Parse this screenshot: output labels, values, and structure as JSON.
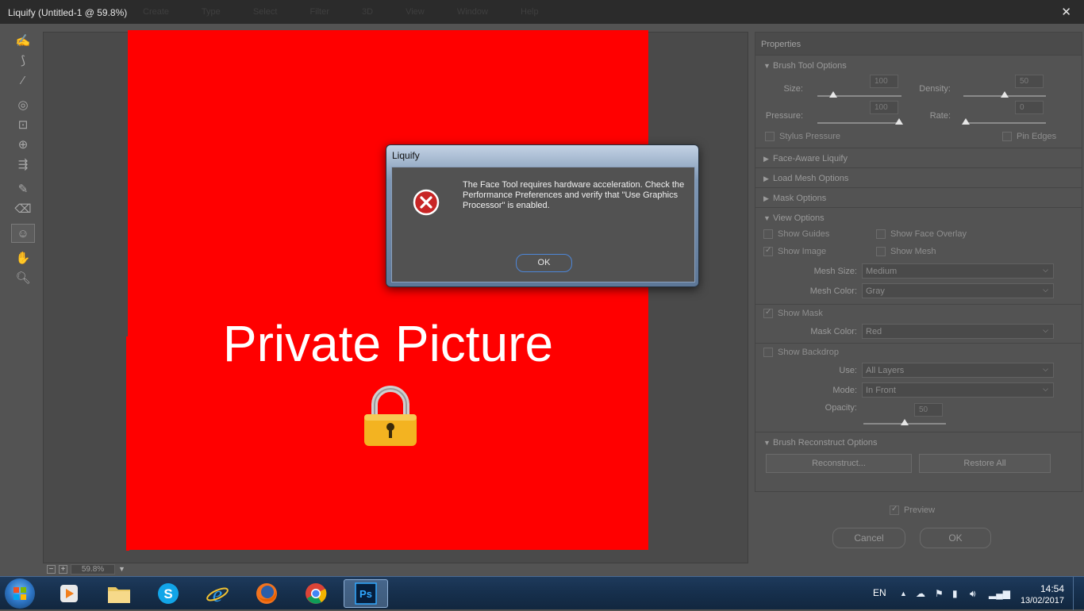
{
  "window": {
    "title": "Liquify (Untitled-1 @ 59.8%)",
    "close_glyph": "✕",
    "ghost_menu": [
      "Create",
      "Type",
      "Select",
      "Filter",
      "3D",
      "View",
      "Window",
      "Help"
    ]
  },
  "canvas": {
    "overlay_text": "Private Picture",
    "zoom": "59.8%"
  },
  "properties": {
    "title": "Properties",
    "brush_tool_options": {
      "label": "Brush Tool Options",
      "size_label": "Size:",
      "size_value": "100",
      "density_label": "Density:",
      "density_value": "50",
      "pressure_label": "Pressure:",
      "pressure_value": "100",
      "rate_label": "Rate:",
      "rate_value": "0",
      "stylus_pressure": "Stylus Pressure",
      "pin_edges": "Pin Edges"
    },
    "face_aware_liquify": "Face-Aware Liquify",
    "load_mesh_options": "Load Mesh Options",
    "mask_options": "Mask Options",
    "view_options": {
      "label": "View Options",
      "show_guides": "Show Guides",
      "show_face_overlay": "Show Face Overlay",
      "show_image": "Show Image",
      "show_mesh": "Show Mesh",
      "mesh_size_label": "Mesh Size:",
      "mesh_size_value": "Medium",
      "mesh_color_label": "Mesh Color:",
      "mesh_color_value": "Gray",
      "show_mask": "Show Mask",
      "mask_color_label": "Mask Color:",
      "mask_color_value": "Red",
      "show_backdrop": "Show Backdrop",
      "use_label": "Use:",
      "use_value": "All Layers",
      "mode_label": "Mode:",
      "mode_value": "In Front",
      "opacity_label": "Opacity:",
      "opacity_value": "50"
    },
    "brush_reconstruct_options": {
      "label": "Brush Reconstruct Options",
      "reconstruct_button": "Reconstruct...",
      "restore_all_button": "Restore All"
    }
  },
  "footer": {
    "preview_label": "Preview",
    "cancel_button": "Cancel",
    "ok_button": "OK"
  },
  "dialog": {
    "title": "Liquify",
    "message": "The Face Tool requires hardware acceleration. Check the Performance Preferences and verify that \"Use Graphics Processor\" is enabled.",
    "ok_button": "OK"
  },
  "taskbar": {
    "language": "EN",
    "time": "14:54",
    "date": "13/02/2017",
    "photoshop_label": "Ps"
  },
  "colors": {
    "image_red": "#ff0000",
    "panel_bg": "#535353",
    "dialog_accent": "#4d86d8"
  }
}
